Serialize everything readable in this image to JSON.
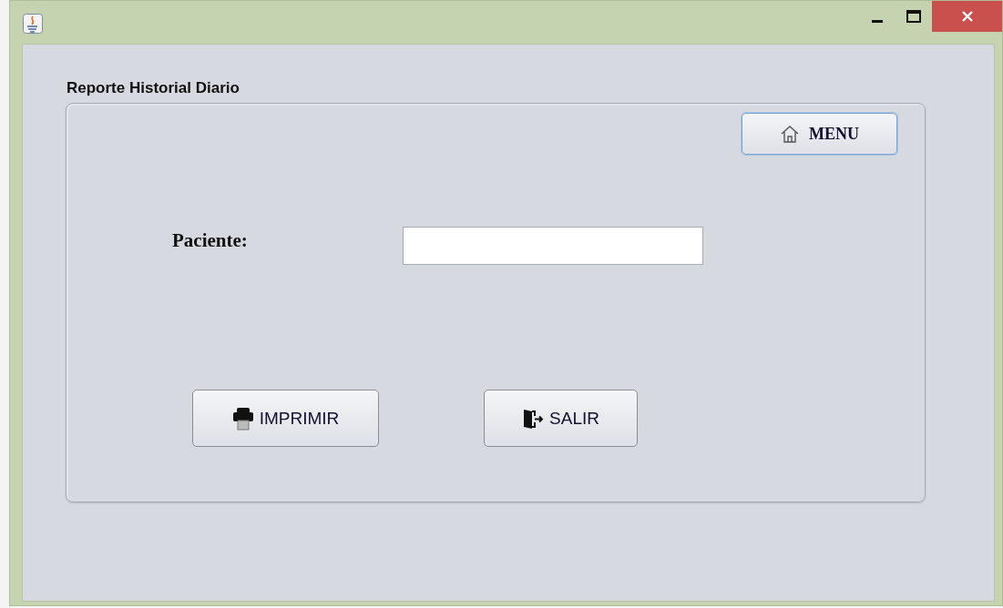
{
  "panel": {
    "title": "Reporte Historial Diario"
  },
  "menu_button": {
    "label": "MENU",
    "focused": true
  },
  "form": {
    "label": "Paciente:"
  },
  "buttons": [
    {
      "kind": "print",
      "label": "IMPRIMIR"
    },
    {
      "kind": "exit",
      "label": "SALIR"
    }
  ]
}
